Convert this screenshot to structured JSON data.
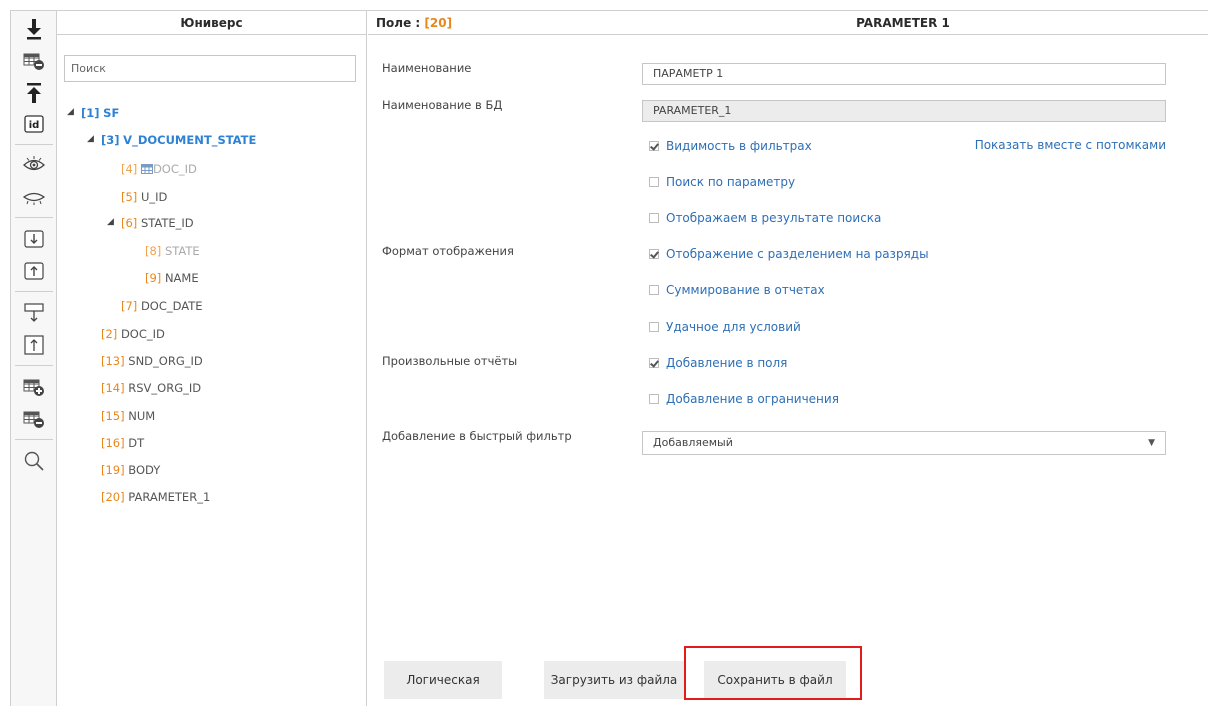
{
  "universe": {
    "title": "Юниверс",
    "search_placeholder": "Поиск",
    "tree": [
      {
        "num": "[1]",
        "name": "SF"
      },
      {
        "num": "[3]",
        "name": "V_DOCUMENT_STATE"
      },
      {
        "num": "[4]",
        "name": "DOC_ID"
      },
      {
        "num": "[5]",
        "name": "U_ID"
      },
      {
        "num": "[6]",
        "name": "STATE_ID"
      },
      {
        "num": "[8]",
        "name": "STATE"
      },
      {
        "num": "[9]",
        "name": "NAME"
      },
      {
        "num": "[7]",
        "name": "DOC_DATE"
      },
      {
        "num": "[2]",
        "name": "DOC_ID"
      },
      {
        "num": "[13]",
        "name": "SND_ORG_ID"
      },
      {
        "num": "[14]",
        "name": "RSV_ORG_ID"
      },
      {
        "num": "[15]",
        "name": "NUM"
      },
      {
        "num": "[16]",
        "name": "DT"
      },
      {
        "num": "[19]",
        "name": "BODY"
      },
      {
        "num": "[20]",
        "name": "PARAMETER_1"
      }
    ]
  },
  "field": {
    "label": "Поле :",
    "num_open": "[",
    "num": "20",
    "num_close": "]",
    "title": "PARAMETER 1",
    "name_label": "Наименование",
    "name_value": "ПАРАМЕТР 1",
    "db_name_label": "Наименование в БД",
    "db_name_value": "PARAMETER_1",
    "display_format_label": "Формат отображения",
    "custom_reports_label": "Произвольные отчёты",
    "quick_filter_label": "Добавление в быстрый фильтр",
    "quick_filter_value": "Добавляемый",
    "show_with_children": "Показать вместе с потомками",
    "checkboxes": [
      {
        "label": "Видимость в фильтрах",
        "checked": true
      },
      {
        "label": "Поиск по параметру",
        "checked": false
      },
      {
        "label": "Отображаем в результате поиска",
        "checked": false
      },
      {
        "label": "Отображение с разделением на разряды",
        "checked": true
      },
      {
        "label": "Суммирование в отчетах",
        "checked": false
      },
      {
        "label": "Удачное для условий",
        "checked": false
      },
      {
        "label": "Добавление в поля",
        "checked": true
      },
      {
        "label": "Добавление в ограничения",
        "checked": false
      }
    ]
  },
  "buttons": {
    "logical": "Логическая",
    "load": "Загрузить из файла",
    "save": "Сохранить в файл"
  }
}
